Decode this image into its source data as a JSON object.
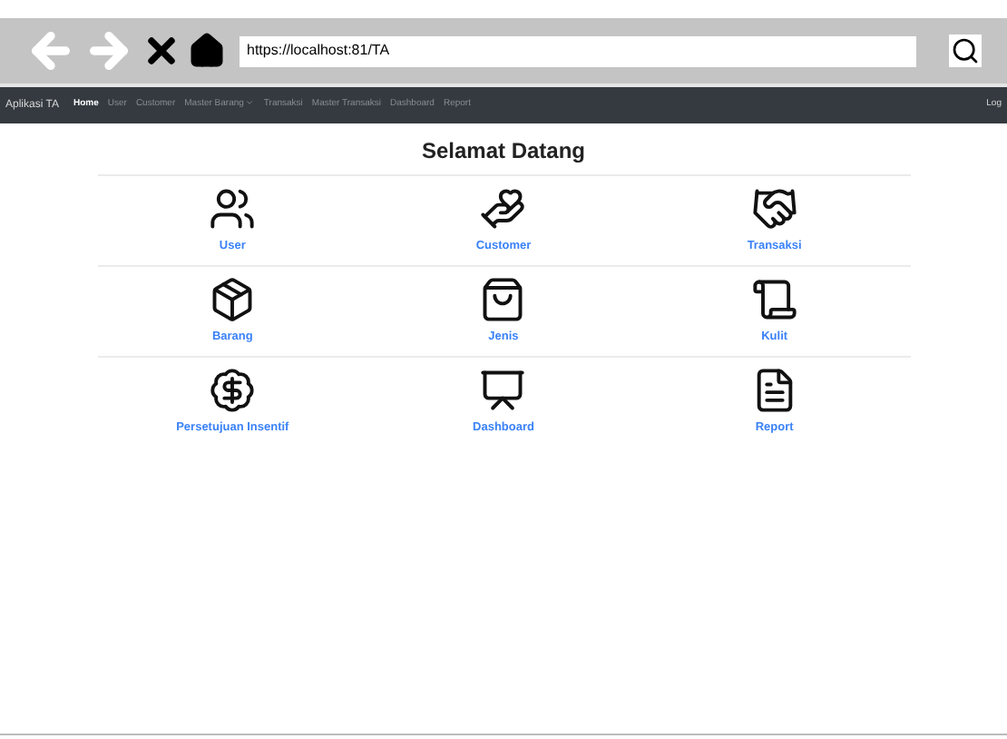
{
  "browser": {
    "url": "https://localhost:81/TA"
  },
  "navbar": {
    "brand": "Aplikasi TA",
    "items": [
      {
        "label": "Home",
        "selected": true
      },
      {
        "label": "User",
        "selected": false
      },
      {
        "label": "Customer",
        "selected": false
      },
      {
        "label": "Master Barang",
        "selected": false,
        "kind": "dropdown"
      },
      {
        "label": "Transaksi",
        "selected": false
      },
      {
        "label": "Master Transaksi",
        "selected": false
      },
      {
        "label": "Dashboard",
        "selected": false
      },
      {
        "label": "Report",
        "selected": false
      }
    ],
    "right_item": "Log"
  },
  "heading": "Selamat Datang",
  "menu_rows": [
    [
      "User",
      "Customer",
      "Transaksi"
    ],
    [
      "Barang",
      "Jenis",
      "Kulit"
    ],
    [
      "Persetujuan Insentif",
      "Dashboard",
      "Report"
    ]
  ]
}
